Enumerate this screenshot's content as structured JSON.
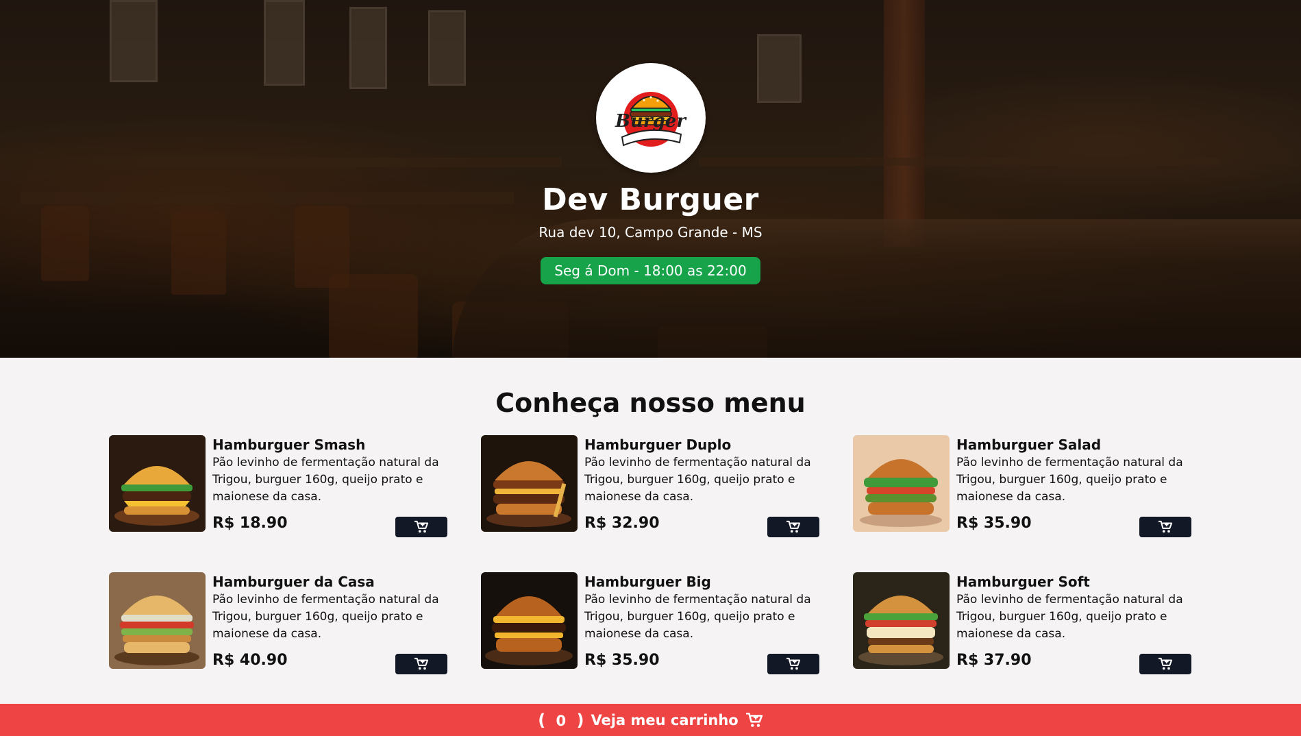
{
  "header": {
    "logo_text": "Burger",
    "title": "Dev Burguer",
    "address": "Rua dev 10, Campo Grande - MS",
    "hours": "Seg á Dom - 18:00 as 22:00"
  },
  "menu": {
    "title": "Conheça nosso menu",
    "items": [
      {
        "name": "Hamburguer Smash",
        "description": "Pão levinho de fermentação natural da Trigou, burguer 160g, queijo prato e maionese da casa.",
        "price": "R$ 18.90"
      },
      {
        "name": "Hamburguer Duplo",
        "description": "Pão levinho de fermentação natural da Trigou, burguer 160g, queijo prato e maionese da casa.",
        "price": "R$ 32.90"
      },
      {
        "name": "Hamburguer Salad",
        "description": "Pão levinho de fermentação natural da Trigou, burguer 160g, queijo prato e maionese da casa.",
        "price": "R$ 35.90"
      },
      {
        "name": "Hamburguer da Casa",
        "description": "Pão levinho de fermentação natural da Trigou, burguer 160g, queijo prato e maionese da casa.",
        "price": "R$ 40.90"
      },
      {
        "name": "Hamburguer Big",
        "description": "Pão levinho de fermentação natural da Trigou, burguer 160g, queijo prato e maionese da casa.",
        "price": "R$ 35.90"
      },
      {
        "name": "Hamburguer Soft",
        "description": "Pão levinho de fermentação natural da Trigou, burguer 160g, queijo prato e maionese da casa.",
        "price": "R$ 37.90"
      }
    ]
  },
  "footer": {
    "open_paren": "(",
    "count": "0",
    "close_paren": ")",
    "label": "Veja meu carrinho",
    "icon": "cart-icon"
  },
  "colors": {
    "hours_badge": "#16a34a",
    "cart_button": "#121826",
    "footer_bar": "#ef4444",
    "background": "#f5f3f3"
  }
}
